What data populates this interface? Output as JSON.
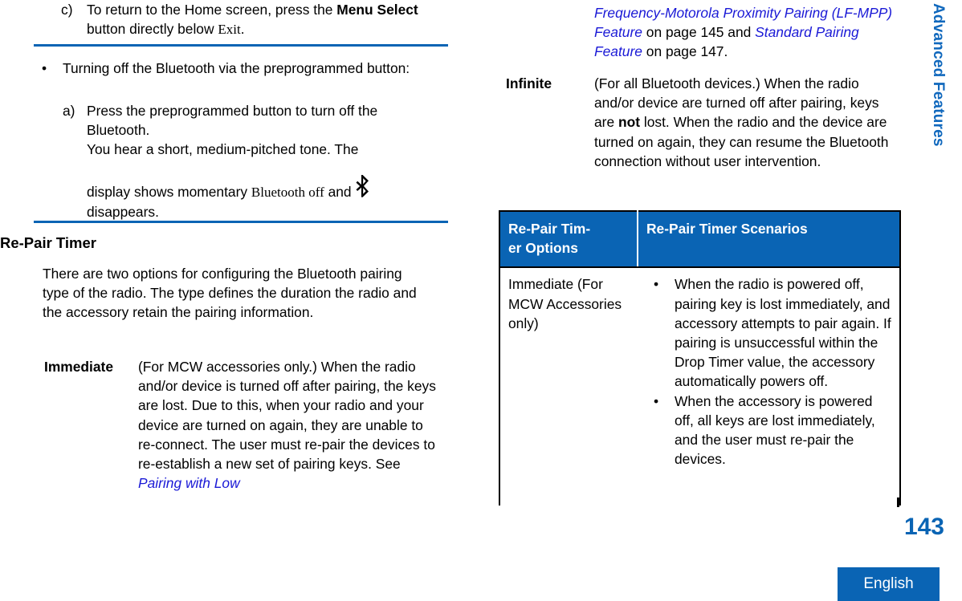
{
  "document": {
    "page_number": "143",
    "language_badge": "English",
    "side_tab": "Advanced Features"
  },
  "colors": {
    "accent_blue": "#0a64b4",
    "link_blue": "#1a19d6",
    "side_tab_blue": "#1068bd",
    "table_header_bg": "#0a64b4",
    "text_black": "#000000"
  },
  "left_column": {
    "step_c": {
      "marker": "c)",
      "text_1": "To return to the Home screen, press the ",
      "bold_1": "Menu Select",
      "text_2": " button directly below ",
      "serif_1": "Exit",
      "text_3": "."
    },
    "bullet_turning_off": {
      "dot": "•",
      "text": "Turning off the Bluetooth via the preprogrammed button:"
    },
    "step_a": {
      "marker": "a)",
      "line_1": "Press the preprogrammed button to turn off the Bluetooth.",
      "line_2": "You hear a short, medium-pitched tone. The",
      "line_3_pre": "display shows momentary ",
      "line_3_serif": "Bluetooth off",
      "line_3_mid": " and ",
      "icon": "bluetooth-icon",
      "line_4": "disappears."
    },
    "heading": "Re-Pair Timer",
    "intro_paragraph": "There are two options for configuring the Bluetooth pairing type of the radio. The type defines the duration the radio and the accessory retain the pairing information.",
    "definition_immediate": {
      "term": "Immediate",
      "body_text": "(For MCW accessories only.) When the radio and/or device is turned off after pairing, the keys are lost. Due to this, when your radio and your device are turned on again, they are unable to re-connect. The user must re-pair the devices to re-establish a new set of pairing keys. See ",
      "link_text": "Pairing with Low"
    }
  },
  "right_column": {
    "continued_reference": {
      "link_1": "Frequency-Motorola Proximity Pairing (LF-MPP) Feature",
      "text_1": " on page 145 and ",
      "link_2": "Standard Pairing Feature",
      "text_2": " on page 147."
    },
    "definition_infinite": {
      "term": "Infinite",
      "body_pre": "(For all Bluetooth devices.) When the radio and/or device are turned off after pairing, keys are ",
      "body_bold": "not",
      "body_post": " lost. When the radio and the device are turned on again, they can resume the Bluetooth connection without user intervention."
    }
  },
  "table": {
    "headers": [
      "Re-Pair Tim-er Options",
      "Re-Pair Timer Scenarios"
    ],
    "header_col1_line1": "Re-Pair Tim-",
    "header_col1_line2": "er Options",
    "header_col2": "Re-Pair Timer Scenarios",
    "rows": [
      {
        "option": "Immediate (For MCW Accessories only)",
        "scenarios": [
          "When the radio is powered off, pairing key is lost immediately, and accessory attempts to pair again. If pairing is unsuccessful within the Drop Timer value, the accessory automatically powers off.",
          "When the accessory is powered off, all keys are lost immediately, and the user must re-pair the devices."
        ]
      }
    ],
    "bullet_char": "•"
  }
}
